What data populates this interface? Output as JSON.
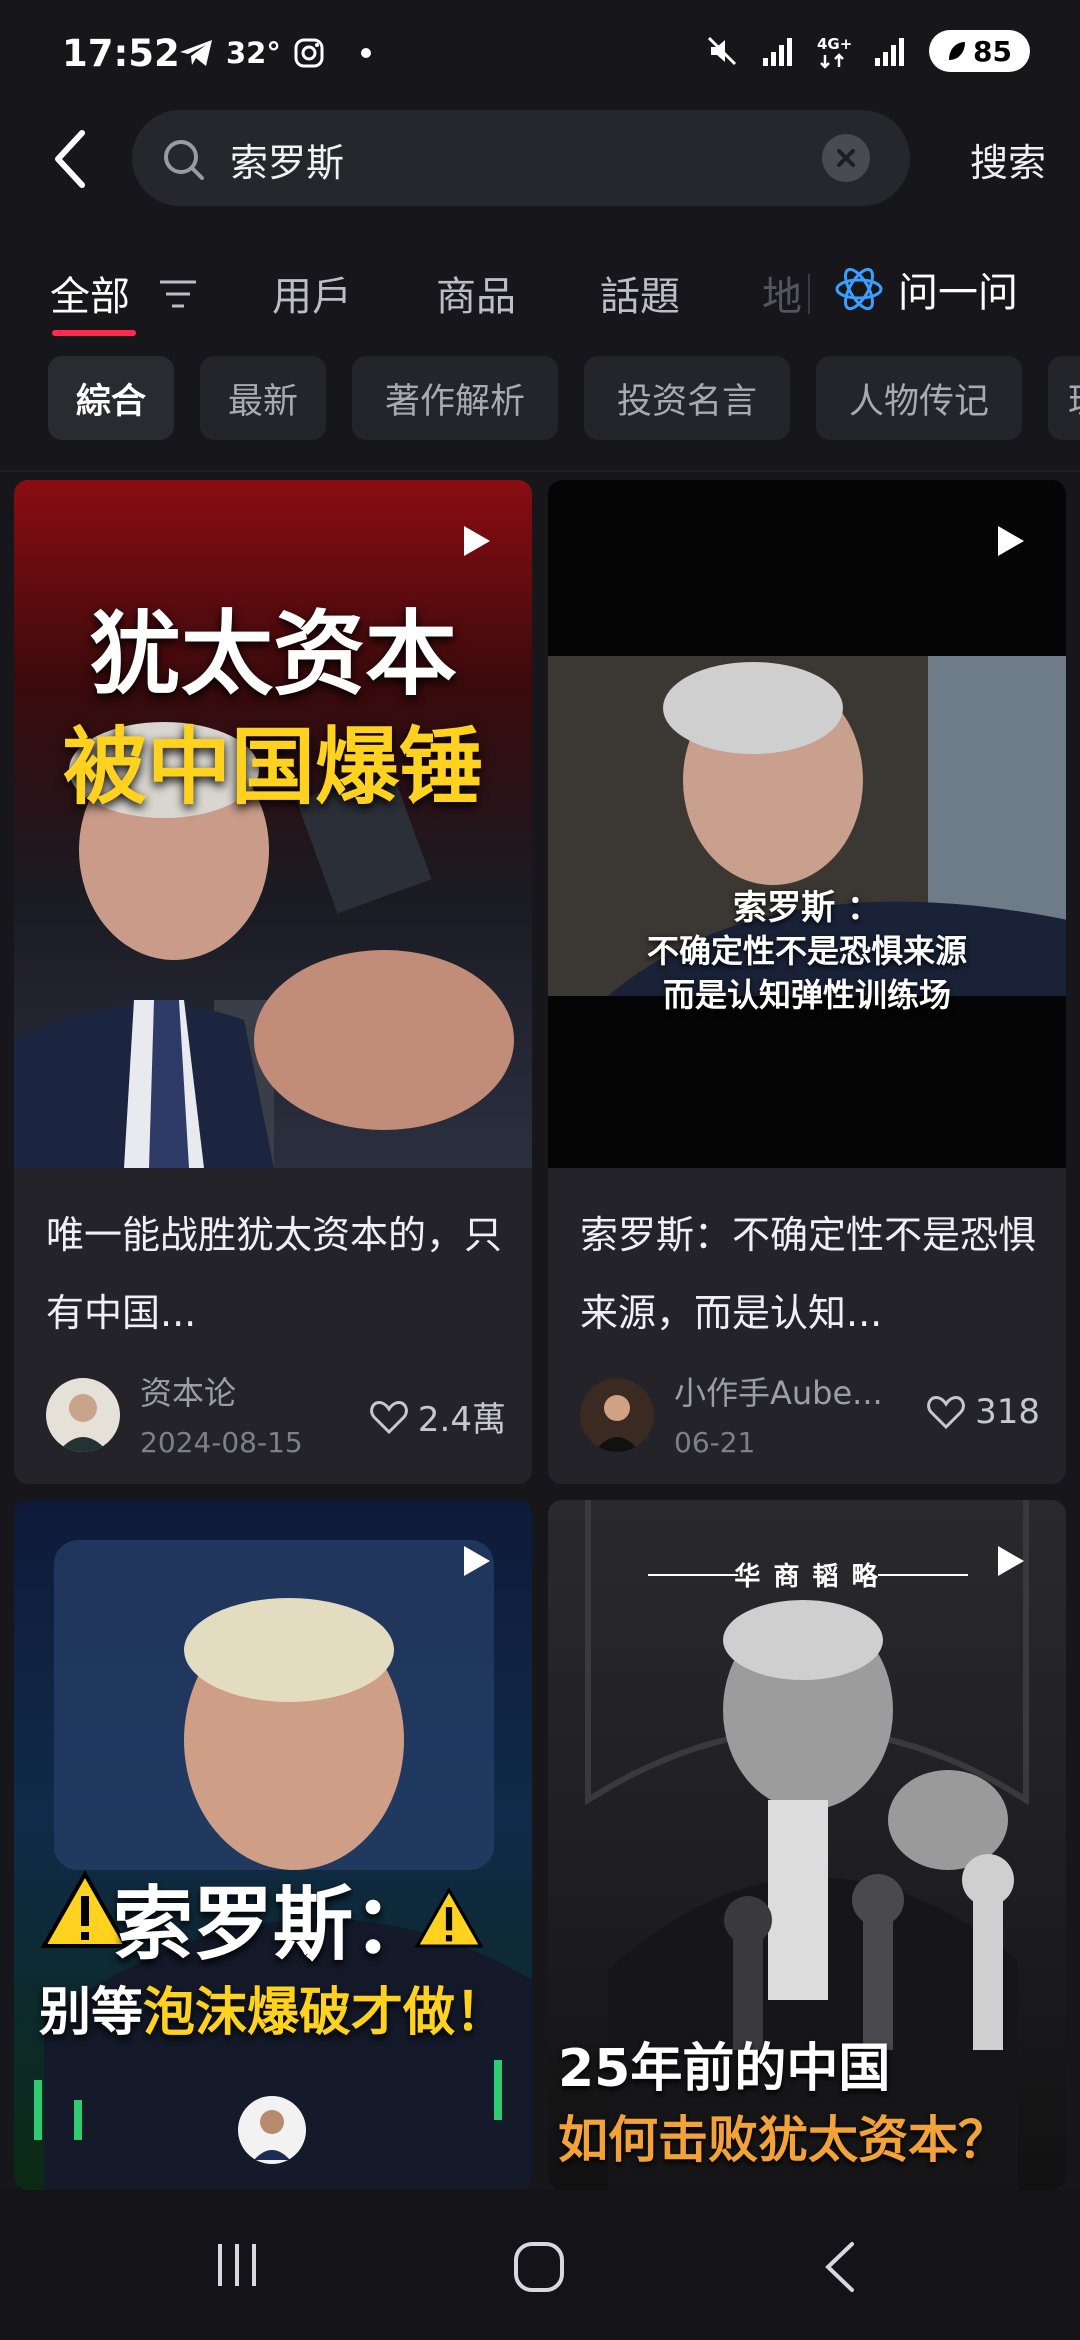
{
  "status_bar": {
    "time": "17:52",
    "temperature": "32°",
    "battery": "85",
    "icons": [
      "telegram-icon",
      "instagram-icon",
      "mute-icon",
      "signal-icon",
      "4g-icon",
      "signal-icon-2"
    ]
  },
  "search": {
    "query": "索罗斯",
    "button_label": "搜索"
  },
  "tabs": [
    {
      "label": "全部",
      "active": true
    },
    {
      "label": "用戶"
    },
    {
      "label": "商品"
    },
    {
      "label": "話題"
    }
  ],
  "tab_cutoff": "地",
  "ask_label": "问一问",
  "chips": [
    {
      "label": "綜合",
      "active": true
    },
    {
      "label": "最新"
    },
    {
      "label": "著作解析"
    },
    {
      "label": "投资名言"
    },
    {
      "label": "人物传记"
    },
    {
      "label": "理"
    }
  ],
  "cards": [
    {
      "thumb_line1": "犹太资本",
      "thumb_line2": "被中国爆锤",
      "title": "唯一能战胜犹太资本的，只有中国...",
      "author": "资本论",
      "date": "2024-08-15",
      "likes": "2.4萬"
    },
    {
      "thumb_line1": "索罗斯 ：",
      "thumb_line2": "不确定性不是恐惧来源",
      "thumb_line3": "而是认知弹性训练场",
      "title": "索罗斯：不确定性不是恐惧来源，而是认知...",
      "author": "小作手Aube...",
      "date": "06-21",
      "likes": "318"
    },
    {
      "thumb_line1": "索罗斯：",
      "thumb_line2_a": "别等",
      "thumb_line2_b": "泡沫爆破才做！"
    },
    {
      "thumb_top": "华 商 韬 略",
      "thumb_line1": "25年前的中国",
      "thumb_line2": "如何击败犹太资本？"
    }
  ],
  "colors": {
    "background": "#16161b",
    "accent": "#ff2a4d",
    "card": "#232329",
    "gold": "#ffc928"
  }
}
